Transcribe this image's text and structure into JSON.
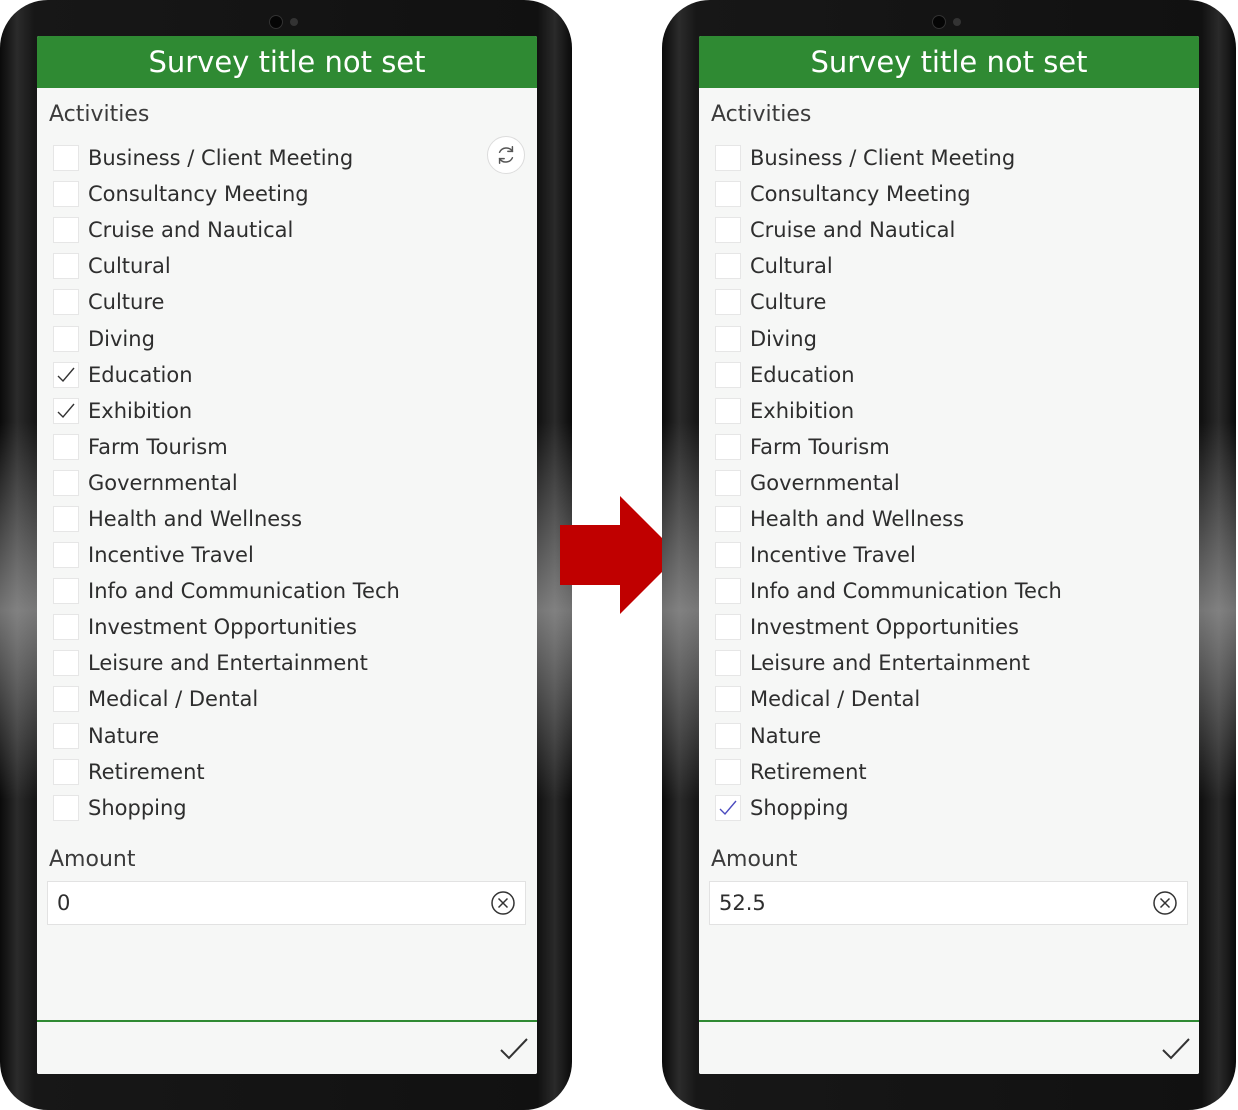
{
  "colors": {
    "header": "#2f8a33",
    "arrow": "#c00000"
  },
  "left_screen": {
    "title": "Survey title not set",
    "activities_label": "Activities",
    "amount_label": "Amount",
    "amount_value": "0",
    "items": [
      {
        "label": "Business / Client Meeting",
        "checked": false
      },
      {
        "label": "Consultancy Meeting",
        "checked": false
      },
      {
        "label": "Cruise and Nautical",
        "checked": false
      },
      {
        "label": "Cultural",
        "checked": false
      },
      {
        "label": "Culture",
        "checked": false
      },
      {
        "label": "Diving",
        "checked": false
      },
      {
        "label": "Education",
        "checked": true
      },
      {
        "label": "Exhibition",
        "checked": true
      },
      {
        "label": "Farm Tourism",
        "checked": false
      },
      {
        "label": "Governmental",
        "checked": false
      },
      {
        "label": "Health and Wellness",
        "checked": false
      },
      {
        "label": "Incentive Travel",
        "checked": false
      },
      {
        "label": "Info and Communication Tech",
        "checked": false
      },
      {
        "label": "Investment Opportunities",
        "checked": false
      },
      {
        "label": "Leisure and Entertainment",
        "checked": false
      },
      {
        "label": "Medical / Dental",
        "checked": false
      },
      {
        "label": "Nature",
        "checked": false
      },
      {
        "label": "Retirement",
        "checked": false
      },
      {
        "label": "Shopping",
        "checked": false
      }
    ]
  },
  "right_screen": {
    "title": "Survey title not set",
    "activities_label": "Activities",
    "amount_label": "Amount",
    "amount_value": "52.5",
    "items": [
      {
        "label": "Business / Client Meeting",
        "checked": false
      },
      {
        "label": "Consultancy Meeting",
        "checked": false
      },
      {
        "label": "Cruise and Nautical",
        "checked": false
      },
      {
        "label": "Cultural",
        "checked": false
      },
      {
        "label": "Culture",
        "checked": false
      },
      {
        "label": "Diving",
        "checked": false
      },
      {
        "label": "Education",
        "checked": false
      },
      {
        "label": "Exhibition",
        "checked": false
      },
      {
        "label": "Farm Tourism",
        "checked": false
      },
      {
        "label": "Governmental",
        "checked": false
      },
      {
        "label": "Health and Wellness",
        "checked": false
      },
      {
        "label": "Incentive Travel",
        "checked": false
      },
      {
        "label": "Info and Communication Tech",
        "checked": false
      },
      {
        "label": "Investment Opportunities",
        "checked": false
      },
      {
        "label": "Leisure and Entertainment",
        "checked": false
      },
      {
        "label": "Medical / Dental",
        "checked": false
      },
      {
        "label": "Nature",
        "checked": false
      },
      {
        "label": "Retirement",
        "checked": false
      },
      {
        "label": "Shopping",
        "checked": true
      }
    ]
  },
  "icons": {
    "refresh": "refresh-icon",
    "clear": "clear-circle-x-icon",
    "submit": "checkmark-icon",
    "transition": "right-arrow-icon"
  }
}
